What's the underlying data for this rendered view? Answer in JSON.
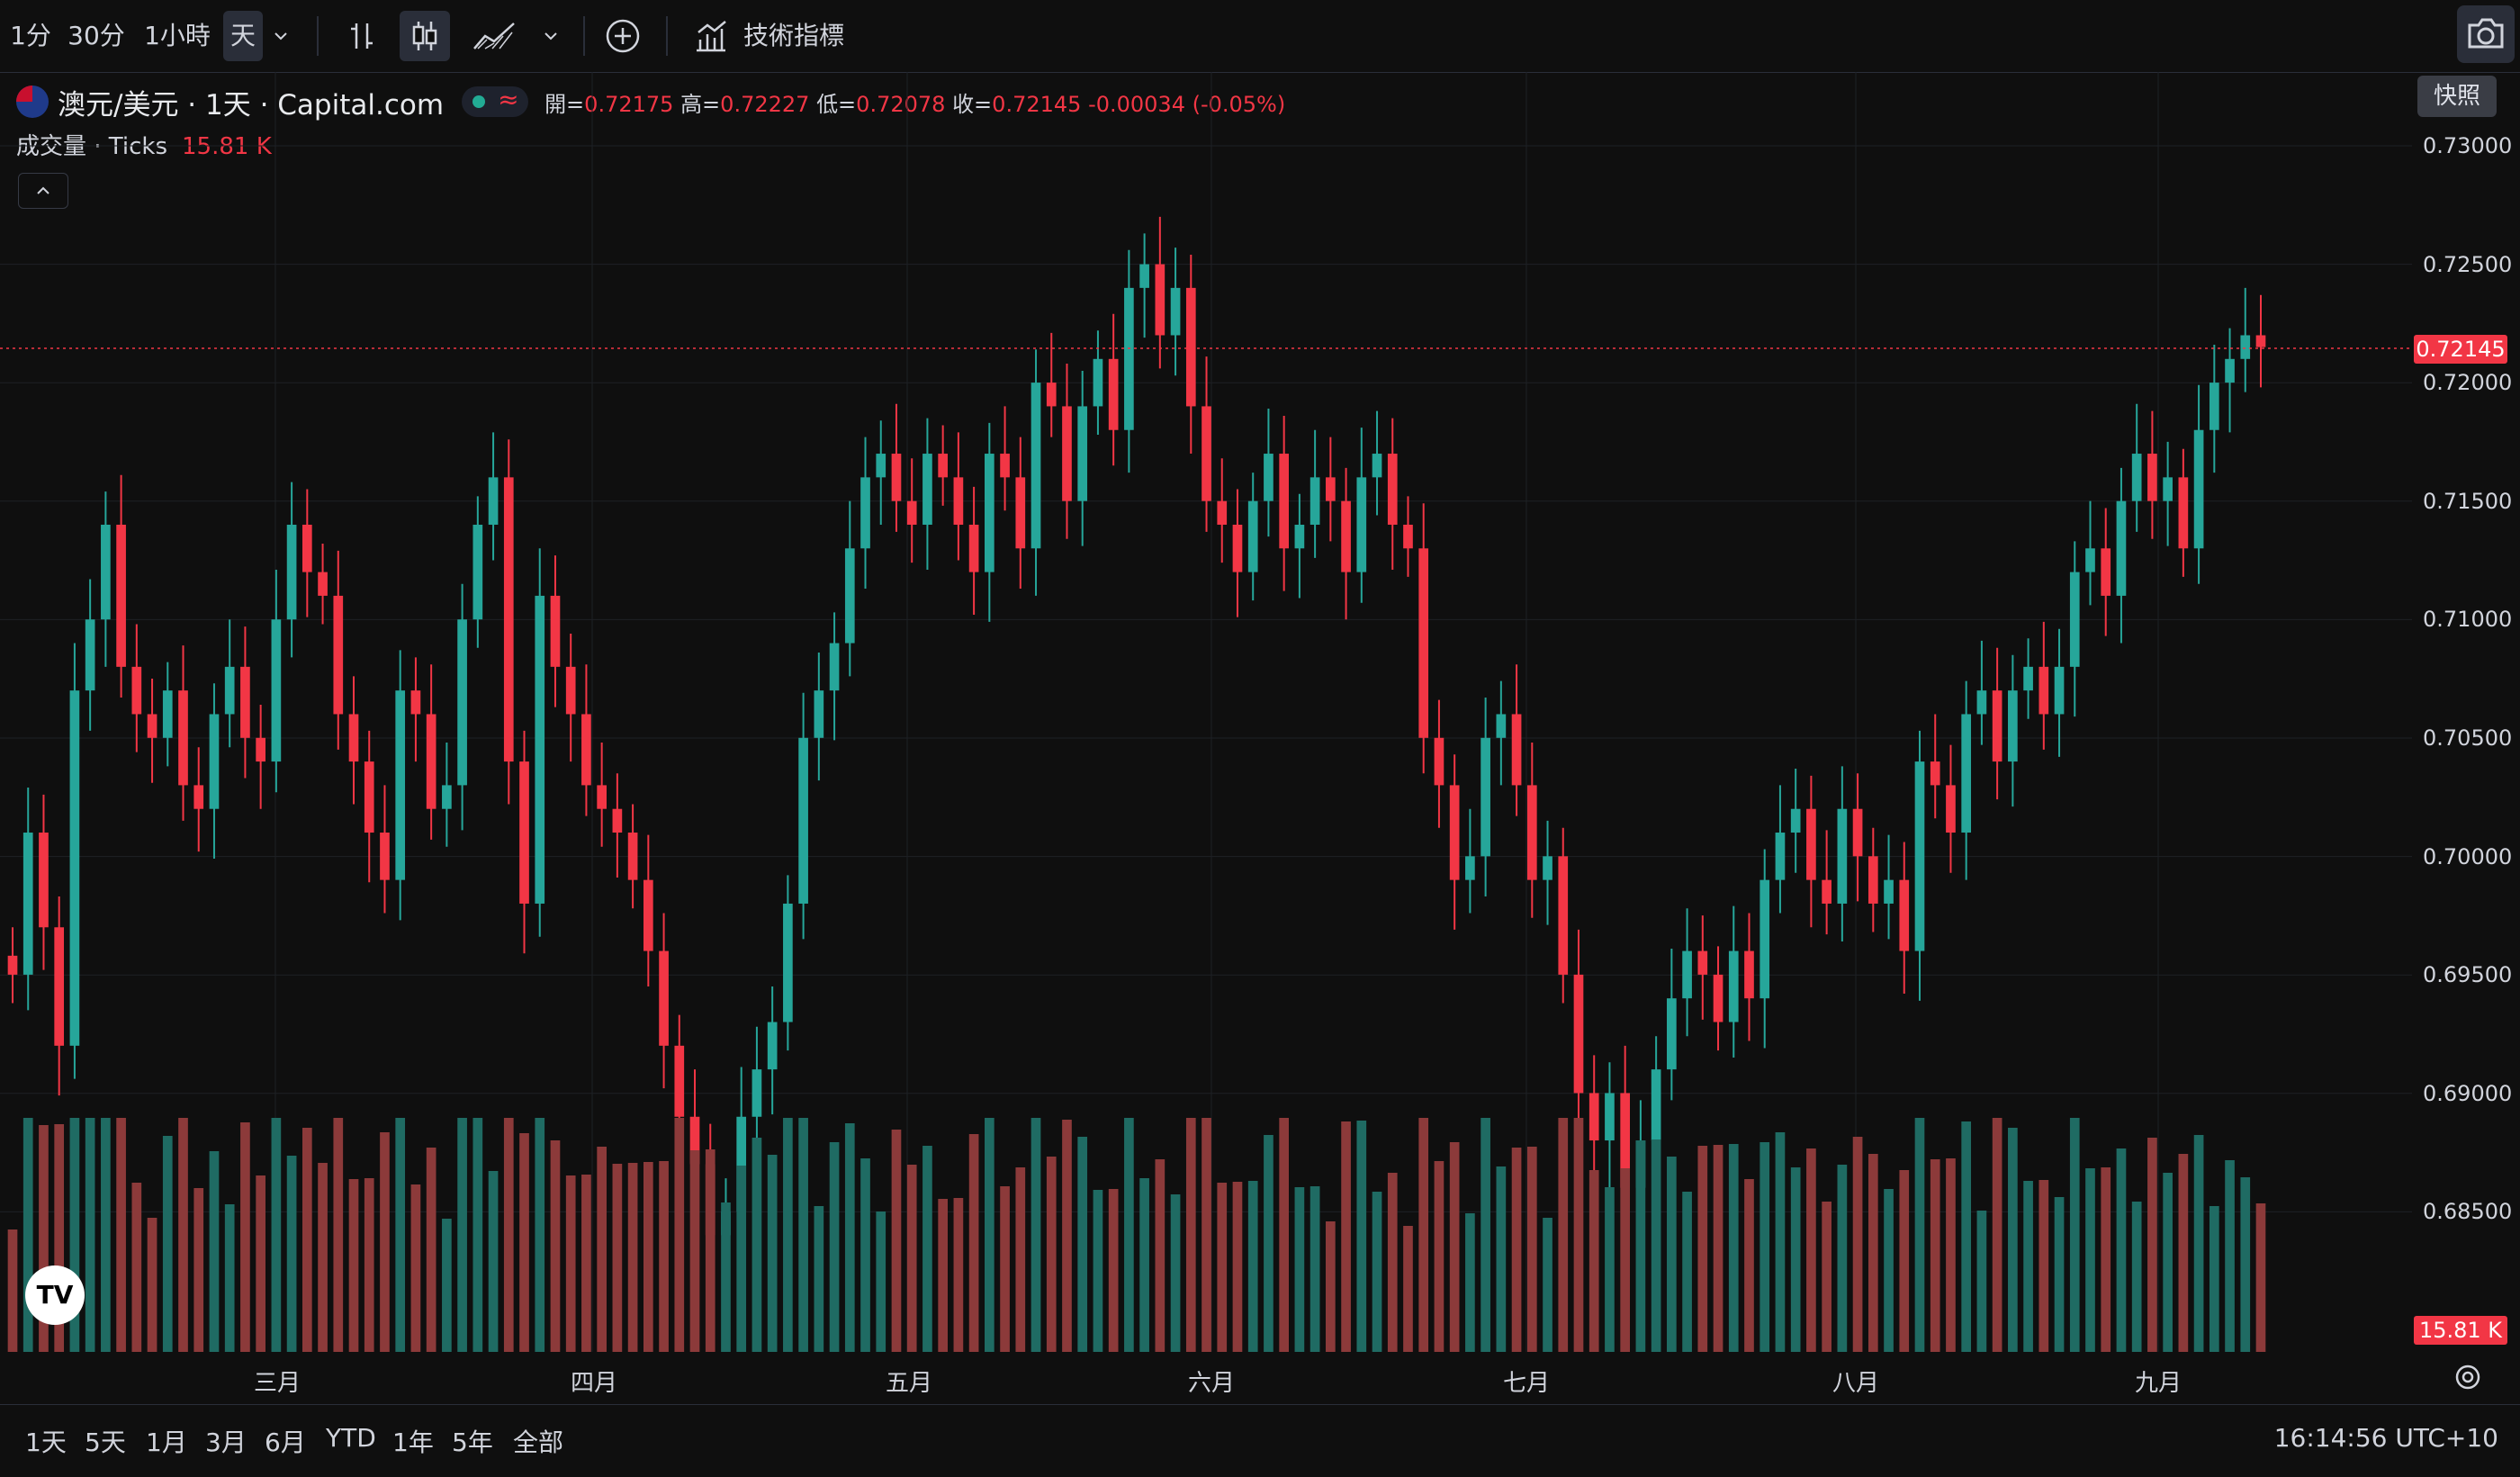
{
  "toolbar": {
    "intervals": [
      "1分",
      "30分",
      "1小時",
      "天"
    ],
    "indicators_label": "技術指標"
  },
  "snapshot_tooltip": "快照",
  "legend": {
    "symbol": "澳元/美元 · 1天 · Capital.com",
    "open_label": "開=",
    "open": "0.72175",
    "high_label": "高=",
    "high": "0.72227",
    "low_label": "低=",
    "low": "0.72078",
    "close_label": "收=",
    "close": "0.72145",
    "change": "-0.00034 (-0.05%)",
    "volume_label": "成交量 · Ticks",
    "volume_value": "15.81 K"
  },
  "price_axis": {
    "labels": [
      "0.73000",
      "0.72500",
      "0.72000",
      "0.71500",
      "0.71000",
      "0.70500",
      "0.70000",
      "0.69500",
      "0.69000",
      "0.68500"
    ],
    "last_price": "0.72145",
    "volume_tag": "15.81 K"
  },
  "time_axis": {
    "months": [
      "三月",
      "四月",
      "五月",
      "六月",
      "七月",
      "八月",
      "九月"
    ]
  },
  "ranges": [
    "1天",
    "5天",
    "1月",
    "3月",
    "6月",
    "YTD",
    "1年",
    "5年",
    "全部"
  ],
  "clock": "16:14:56 UTC+10",
  "logo": "TV",
  "colors": {
    "up": "#26a69a",
    "up_vol": "#1f6b63",
    "down": "#f23645",
    "down_vol": "#8c3a3a",
    "background": "#0f0f0f",
    "grid": "#1e2025"
  },
  "chart_data": {
    "type": "candlestick",
    "symbol": "AUD/USD",
    "interval": "1D",
    "ylim": [
      0.685,
      0.73
    ],
    "x_months": [
      "三月",
      "四月",
      "五月",
      "六月",
      "七月",
      "八月",
      "九月"
    ],
    "close_values": [
      0.695,
      0.701,
      0.697,
      0.692,
      0.707,
      0.71,
      0.714,
      0.708,
      0.706,
      0.705,
      0.707,
      0.703,
      0.702,
      0.706,
      0.708,
      0.705,
      0.704,
      0.71,
      0.714,
      0.712,
      0.711,
      0.706,
      0.704,
      0.701,
      0.699,
      0.707,
      0.706,
      0.702,
      0.703,
      0.71,
      0.714,
      0.716,
      0.704,
      0.698,
      0.711,
      0.708,
      0.706,
      0.703,
      0.702,
      0.701,
      0.699,
      0.696,
      0.692,
      0.689,
      0.687,
      0.684,
      0.685,
      0.689,
      0.691,
      0.693,
      0.698,
      0.705,
      0.707,
      0.709,
      0.713,
      0.716,
      0.717,
      0.715,
      0.714,
      0.717,
      0.716,
      0.714,
      0.712,
      0.717,
      0.716,
      0.713,
      0.72,
      0.719,
      0.715,
      0.719,
      0.721,
      0.718,
      0.724,
      0.725,
      0.722,
      0.724,
      0.719,
      0.715,
      0.714,
      0.712,
      0.715,
      0.717,
      0.713,
      0.714,
      0.716,
      0.715,
      0.712,
      0.716,
      0.717,
      0.714,
      0.713,
      0.705,
      0.703,
      0.699,
      0.7,
      0.705,
      0.706,
      0.703,
      0.699,
      0.7,
      0.695,
      0.69,
      0.688,
      0.69,
      0.686,
      0.688,
      0.691,
      0.694,
      0.696,
      0.695,
      0.693,
      0.696,
      0.694,
      0.699,
      0.701,
      0.702,
      0.699,
      0.698,
      0.702,
      0.7,
      0.698,
      0.699,
      0.696,
      0.704,
      0.703,
      0.701,
      0.706,
      0.707,
      0.704,
      0.707,
      0.708,
      0.706,
      0.708,
      0.712,
      0.713,
      0.711,
      0.715,
      0.717,
      0.715,
      0.716,
      0.713,
      0.718,
      0.72,
      0.721,
      0.722,
      0.7215
    ],
    "last_close": 0.72145
  }
}
